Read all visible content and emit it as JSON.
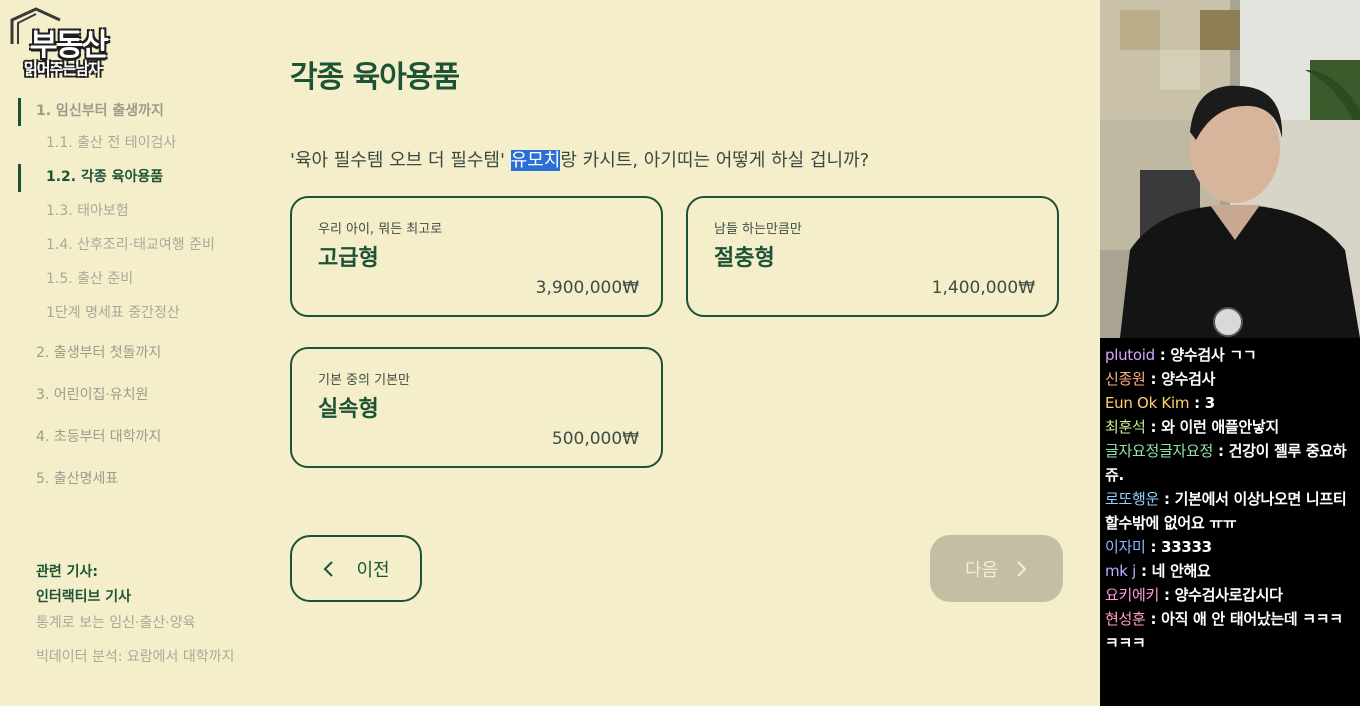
{
  "logo": {
    "line1": "부동산",
    "line2": "읽어주는남자"
  },
  "sidebar": {
    "items": [
      {
        "label": "1. 임신부터 출생까지"
      },
      {
        "label": "1.1. 출산 전 테이검사"
      },
      {
        "label": "1.2. 각종 육아용품"
      },
      {
        "label": "1.3. 태아보험"
      },
      {
        "label": "1.4. 산후조리·태교여행 준비"
      },
      {
        "label": "1.5. 출산 준비"
      },
      {
        "label": "1단계 명세표 중간정산"
      },
      {
        "label": "2. 출생부터 첫돌까지"
      },
      {
        "label": "3. 어린이집·유치원"
      },
      {
        "label": "4. 초등부터 대학까지"
      },
      {
        "label": "5. 출산명세표"
      }
    ],
    "related": {
      "heading": "관련 기사:",
      "items": [
        {
          "label": "인터랙티브 기사"
        },
        {
          "label": "통계로 보는 임신·출산·양육"
        },
        {
          "label": "빅데이터 분석: 요람에서 대학까지"
        }
      ]
    }
  },
  "main": {
    "title": "각종 육아용품",
    "question": {
      "before": "'육아 필수템 오브 더 필수템' ",
      "highlight": "유모치",
      "after": "랑 카시트, 아기띠는 어떻게 하실 겁니까?"
    },
    "options": [
      {
        "sub": "우리 아이, 뭐든 최고로",
        "title": "고급형",
        "price": "3,900,000₩"
      },
      {
        "sub": "남들 하는만큼만",
        "title": "절충형",
        "price": "1,400,000₩"
      },
      {
        "sub": "기본 중의 기본만",
        "title": "실속형",
        "price": "500,000₩"
      }
    ],
    "prev_label": "이전",
    "next_label": "다음"
  },
  "chat": {
    "messages": [
      {
        "name": "plutoid",
        "color": "#d9a3ff",
        "text": "양수검사 ㄱㄱ"
      },
      {
        "name": "신종원",
        "color": "#ffb07a",
        "text": "양수검사"
      },
      {
        "name": "Eun Ok Kim",
        "color": "#ffd36b",
        "text": "3"
      },
      {
        "name": "최훈석",
        "color": "#c8f08f",
        "text": "와 이런 애플안낳지"
      },
      {
        "name": "글자요정글자요정",
        "color": "#8fe3a8",
        "text": "건강이 젤루 중요하쥬."
      },
      {
        "name": "로또행운",
        "color": "#8fd0ff",
        "text": "기본에서 이상나오면 니프티 할수밖에 없어요 ㅠㅠ"
      },
      {
        "name": "이자미",
        "color": "#8fb8ff",
        "text": "33333"
      },
      {
        "name": "mk j",
        "color": "#b9b0ff",
        "text": "네 안해요"
      },
      {
        "name": "요키에키",
        "color": "#ff9bd9",
        "text": "양수검사로갑시다"
      },
      {
        "name": "현성훈",
        "color": "#ffa0c0",
        "text": "아직 애 안 태어났는데 ㅋㅋㅋㅋㅋㅋ"
      }
    ]
  },
  "colors": {
    "brand": "#1c5336",
    "background": "#f4efca",
    "disabled_button": "#c3bfa4"
  }
}
